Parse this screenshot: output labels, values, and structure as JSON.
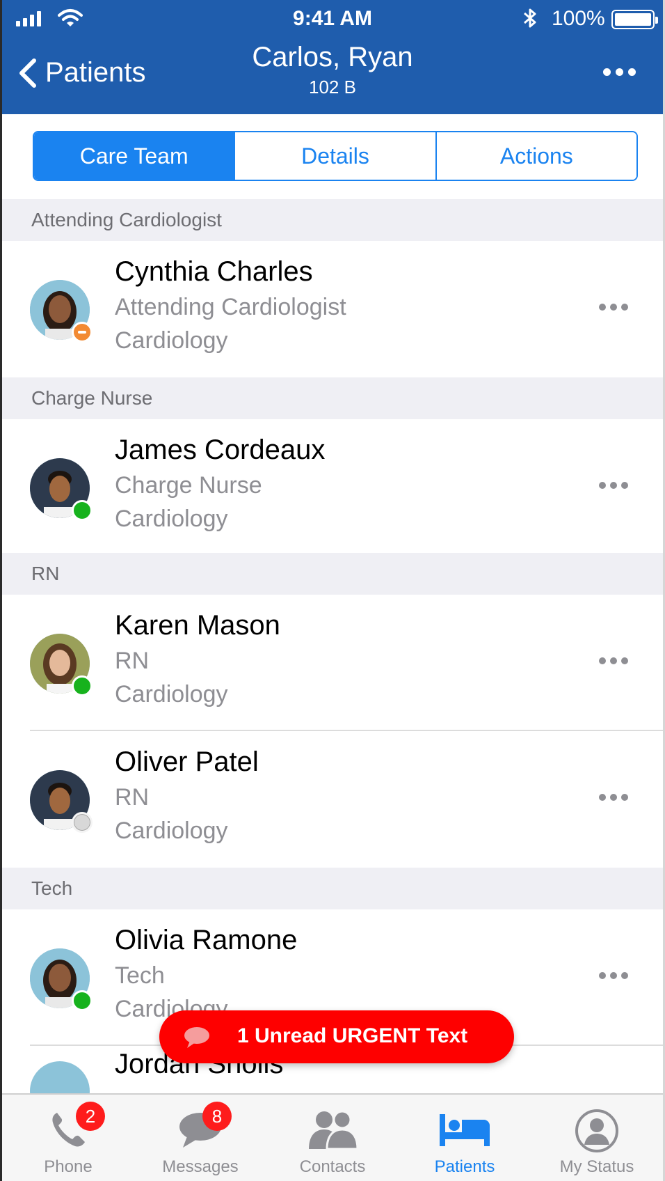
{
  "status_bar": {
    "time": "9:41 AM",
    "battery": "100%"
  },
  "header": {
    "back_label": "Patients",
    "title": "Carlos, Ryan",
    "subtitle": "102 B"
  },
  "tabs": [
    {
      "label": "Care Team",
      "active": true
    },
    {
      "label": "Details",
      "active": false
    },
    {
      "label": "Actions",
      "active": false
    }
  ],
  "sections": [
    {
      "title": "Attending Cardiologist",
      "members": [
        {
          "name": "Cynthia Charles",
          "role": "Attending Cardiologist",
          "dept": "Cardiology",
          "status": "busy"
        }
      ]
    },
    {
      "title": "Charge Nurse",
      "members": [
        {
          "name": "James Cordeaux",
          "role": "Charge Nurse",
          "dept": "Cardiology",
          "status": "online"
        }
      ]
    },
    {
      "title": "RN",
      "members": [
        {
          "name": "Karen Mason",
          "role": "RN",
          "dept": "Cardiology",
          "status": "online"
        },
        {
          "name": "Oliver Patel",
          "role": "RN",
          "dept": "Cardiology",
          "status": "offline"
        }
      ]
    },
    {
      "title": "Tech",
      "members": [
        {
          "name": "Olivia Ramone",
          "role": "Tech",
          "dept": "Cardiology",
          "status": "online"
        },
        {
          "name": "Jordan Sholls"
        }
      ]
    }
  ],
  "urgent": {
    "text": "1 Unread URGENT Text"
  },
  "tabbar": [
    {
      "label": "Phone",
      "icon": "phone-icon",
      "badge": "2"
    },
    {
      "label": "Messages",
      "icon": "messages-icon",
      "badge": "8"
    },
    {
      "label": "Contacts",
      "icon": "contacts-icon"
    },
    {
      "label": "Patients",
      "icon": "patients-bed-icon",
      "active": true
    },
    {
      "label": "My Status",
      "icon": "my-status-icon"
    }
  ],
  "colors": {
    "header": "#1f5dad",
    "accent": "#1a83f0",
    "urgent": "#fe0000",
    "online": "#17b21d",
    "busy": "#f28a33"
  }
}
